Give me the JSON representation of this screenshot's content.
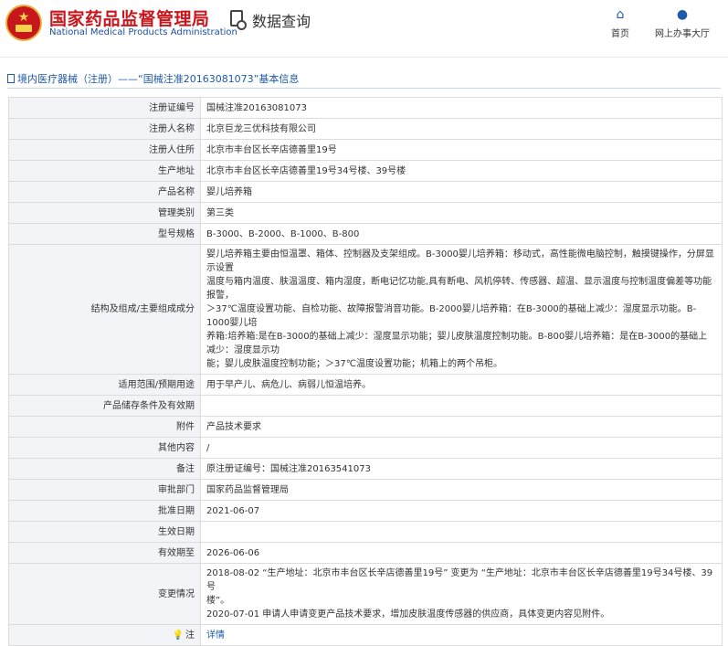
{
  "header": {
    "logo_cn": "国家药品监督管理局",
    "logo_en": "National Medical Products Administration",
    "page_title": "数据查询",
    "nav": {
      "home": "首页",
      "hall": "网上办事大厅"
    }
  },
  "breadcrumb": "境内医疗器械（注册）——“国械注准20163081073”基本信息",
  "rows": {
    "reg_no": {
      "label": "注册证编号",
      "value": "国械注准20163081073"
    },
    "registrant": {
      "label": "注册人名称",
      "value": "北京巨龙三优科技有限公司"
    },
    "address": {
      "label": "注册人住所",
      "value": "北京市丰台区长辛店德善里19号"
    },
    "production": {
      "label": "生产地址",
      "value": "北京市丰台区长辛店德善里19号34号楼、39号楼"
    },
    "product_name": {
      "label": "产品名称",
      "value": "婴儿培养箱"
    },
    "category": {
      "label": "管理类别",
      "value": "第三类"
    },
    "model": {
      "label": "型号规格",
      "value": "B-3000、B-2000、B-1000、B-800"
    },
    "structure": {
      "label": "结构及组成/主要组成成分",
      "lines": [
        "婴儿培养箱主要由恒温罩、箱体、控制器及支架组成。B-3000婴儿培养箱：移动式，高性能微电脑控制，触摸键操作，分屏显示设置",
        "温度与箱内温度、肤温温度、箱内湿度，断电记忆功能,具有断电、风机停转、传感器、超温、显示温度与控制温度偏差等功能报警，",
        "＞37℃温度设置功能、自检功能、故障报警消音功能。B-2000婴儿培养箱：在B-3000的基础上减少：湿度显示功能。B-1000婴儿培",
        "养箱:培养箱:是在B-3000的基础上减少：湿度显示功能；婴儿皮肤温度控制功能。B-800婴儿培养箱：是在B-3000的基础上减少：湿度显示功",
        "能；婴儿皮肤温度控制功能；＞37℃温度设置功能；机箱上的两个吊柜。"
      ]
    },
    "scope": {
      "label": "适用范围/预期用途",
      "value": "用于早产儿、病危儿、病弱儿恒温培养。"
    },
    "storage": {
      "label": "产品储存条件及有效期",
      "value": ""
    },
    "attachment": {
      "label": "附件",
      "value": "产品技术要求"
    },
    "other": {
      "label": "其他内容",
      "value": "/"
    },
    "remark": {
      "label": "备注",
      "value": "原注册证编号：国械注准20163541073"
    },
    "authority": {
      "label": "审批部门",
      "value": "国家药品监督管理局"
    },
    "approval_date": {
      "label": "批准日期",
      "value": "2021-06-07"
    },
    "effective_date": {
      "label": "生效日期",
      "value": ""
    },
    "expiry_date": {
      "label": "有效期至",
      "value": "2026-06-06"
    },
    "changes": {
      "label": "变更情况",
      "lines": [
        "2018-08-02 “生产地址：北京市丰台区长辛店德善里19号” 变更为 “生产地址：北京市丰台区长辛店德善里19号34号楼、39号",
        "楼”。",
        "2020-07-01 申请人申请变更产品技术要求，增加皮肤温度传感器的供应商，具体变更内容见附件。"
      ]
    },
    "note": {
      "label": "注",
      "icon": "note-icon",
      "value": "详情"
    }
  }
}
